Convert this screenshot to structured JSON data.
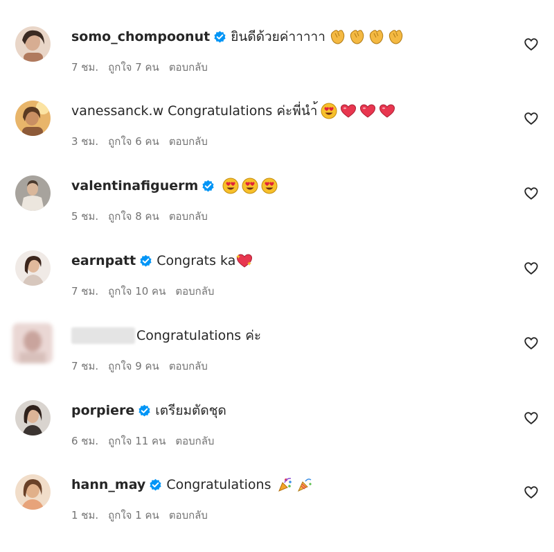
{
  "comments": [
    {
      "username": "somo_chompoonut",
      "verified": true,
      "text": "ยินดีด้วยค่าาาาา",
      "emojis": [
        "clap",
        "clap",
        "clap",
        "clap"
      ],
      "time": "7 ชม.",
      "likes": "ถูกใจ 7 คน",
      "reply": "ตอบกลับ",
      "avatar_color": "#c8a58e"
    },
    {
      "username": "vanessanck.w",
      "verified": false,
      "text": "Congratulations ค่ะพี่นำ้",
      "emojis": [
        "heart-eyes",
        "heart",
        "heart",
        "heart"
      ],
      "time": "3 ชม.",
      "likes": "ถูกใจ 6 คน",
      "reply": "ตอบกลับ",
      "avatar_color": "#b88a4c"
    },
    {
      "username": "valentinafiguerm",
      "verified": true,
      "text": "",
      "emojis": [
        "heart-eyes",
        "heart-eyes",
        "heart-eyes"
      ],
      "time": "5 ชม.",
      "likes": "ถูกใจ 8 คน",
      "reply": "ตอบกลับ",
      "avatar_color": "#8d8d8d"
    },
    {
      "username": "earnpatt",
      "verified": true,
      "text": "Congrats ka",
      "emojis": [
        "heart-sparkle"
      ],
      "time": "7 ชม.",
      "likes": "ถูกใจ 10 คน",
      "reply": "ตอบกลับ",
      "avatar_color": "#7b5a48"
    },
    {
      "username": "",
      "verified": false,
      "text": "Congratulations ค่ะ",
      "emojis": [],
      "time": "7 ชม.",
      "likes": "ถูกใจ 9 คน",
      "reply": "ตอบกลับ",
      "avatar_color": "#d7c3bf"
    },
    {
      "username": "porpiere",
      "verified": true,
      "text": "เตรียมตัดชุด",
      "emojis": [],
      "time": "6 ชม.",
      "likes": "ถูกใจ 11 คน",
      "reply": "ตอบกลับ",
      "avatar_color": "#5a4a42"
    },
    {
      "username": "hann_may",
      "verified": true,
      "text": "Congratulations",
      "emojis": [
        "party-popper-alt",
        "party-popper"
      ],
      "time": "1 ชม.",
      "likes": "ถูกใจ 1 คน",
      "reply": "ตอบกลับ",
      "avatar_color": "#c98d5d"
    }
  ],
  "colors": {
    "verified": "#0095f6",
    "meta_text": "#737373",
    "primary_text": "#262626"
  }
}
